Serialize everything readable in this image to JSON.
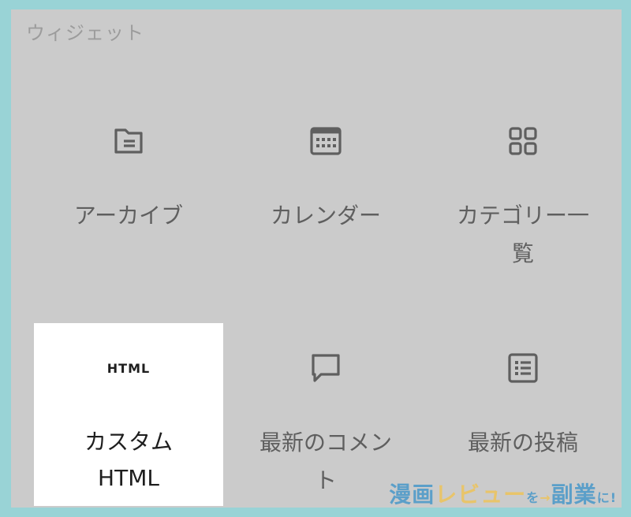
{
  "section": {
    "title": "ウィジェット"
  },
  "blocks": [
    {
      "label": "アーカイブ",
      "icon": "archive-folder-icon"
    },
    {
      "label": "カレンダー",
      "icon": "calendar-icon"
    },
    {
      "label": "カテゴリー一\n覧",
      "icon": "categories-grid-icon"
    },
    {
      "label": "カスタム\nHTML",
      "icon": "html-icon",
      "icon_text": "HTML",
      "selected": true
    },
    {
      "label": "最新のコメン\nト",
      "icon": "comment-icon"
    },
    {
      "label": "最新の投稿",
      "icon": "post-list-icon"
    }
  ],
  "watermark": {
    "part1": "漫画",
    "part2": "レビュー",
    "part3": "を",
    "part4": "→",
    "part5": "副業",
    "part6": "に!",
    "colors": {
      "blue": "#5b9fc9",
      "yellow": "#e8c46a",
      "light": "#bfe0f0"
    }
  }
}
